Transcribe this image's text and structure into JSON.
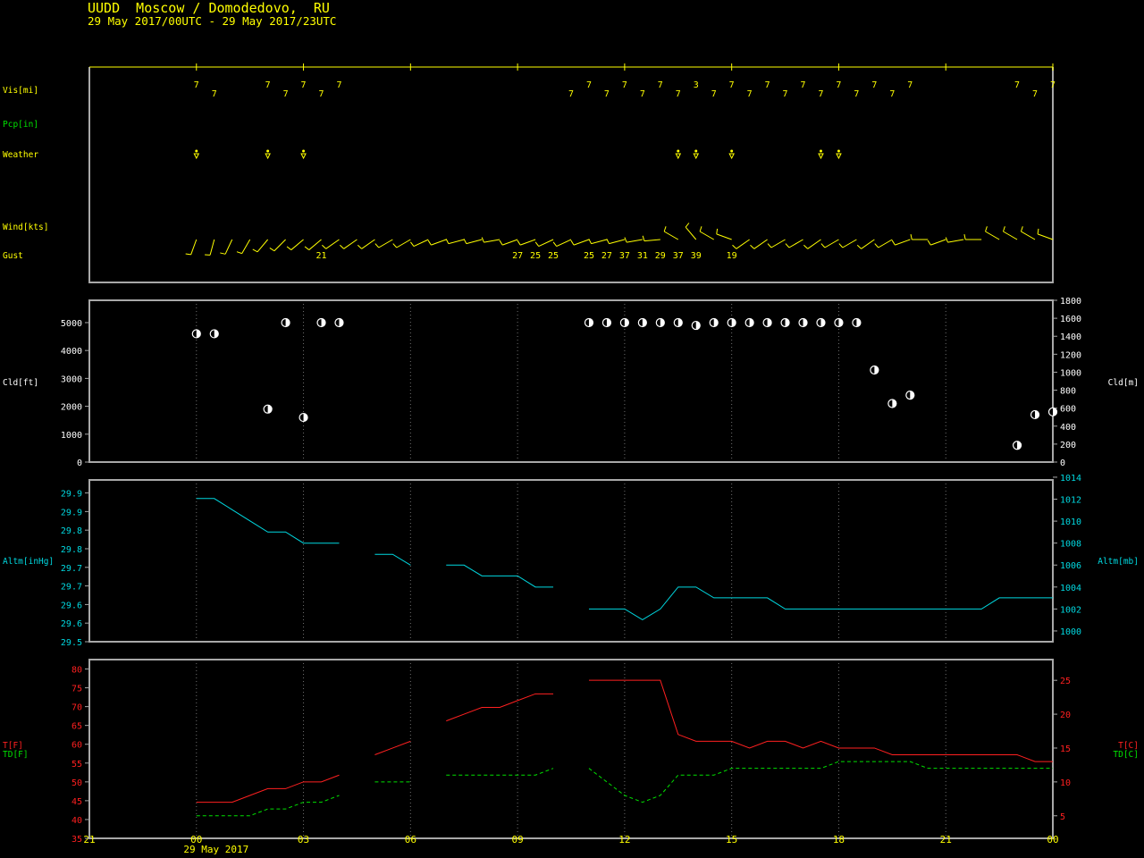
{
  "header": {
    "title": "UUDD  Moscow / Domodedovo,  RU",
    "range": "29 May 2017/00UTC - 29 May 2017/23UTC"
  },
  "time_axis": {
    "tick_labels": [
      "21",
      "00",
      "03",
      "06",
      "09",
      "12",
      "15",
      "18",
      "21",
      "00"
    ],
    "tick_hours": [
      -3,
      0,
      3,
      6,
      9,
      12,
      15,
      18,
      21,
      24
    ],
    "date_label": "29 May 2017"
  },
  "colors": {
    "background": "#000000",
    "frame": "#a8a8a8",
    "grid": "#707070",
    "yellow": "#ffff00",
    "green": "#00e000",
    "cyan": "#00d8e0",
    "red": "#ff2020",
    "white": "#ffffff"
  },
  "chart_data": [
    {
      "type": "table",
      "panel": "surface-observations",
      "rows": {
        "vis": "Vis[mi]",
        "pcp": "Pcp[in]",
        "weather": "Weather",
        "wind": "Wind[kts]",
        "gust": "Gust"
      },
      "visibility": [
        [
          0,
          "7"
        ],
        [
          0.5,
          "7"
        ],
        [
          2,
          "7"
        ],
        [
          2.5,
          "7"
        ],
        [
          3,
          "7"
        ],
        [
          3.5,
          "7"
        ],
        [
          4,
          "7"
        ],
        [
          10.5,
          "7"
        ],
        [
          11,
          "7"
        ],
        [
          11.5,
          "7"
        ],
        [
          12,
          "7"
        ],
        [
          12.5,
          "7"
        ],
        [
          13,
          "7"
        ],
        [
          13.5,
          "7"
        ],
        [
          14,
          "3"
        ],
        [
          14.5,
          "7"
        ],
        [
          15,
          "7"
        ],
        [
          15.5,
          "7"
        ],
        [
          16,
          "7"
        ],
        [
          16.5,
          "7"
        ],
        [
          17,
          "7"
        ],
        [
          17.5,
          "7"
        ],
        [
          18,
          "7"
        ],
        [
          18.5,
          "7"
        ],
        [
          19,
          "7"
        ],
        [
          19.5,
          "7"
        ],
        [
          20,
          "7"
        ],
        [
          23,
          "7"
        ],
        [
          23.5,
          "7"
        ],
        [
          24,
          "7"
        ]
      ],
      "weather_symbols": [
        0,
        2,
        3,
        13.5,
        14,
        15,
        17.5,
        18
      ],
      "wind_barbs": [
        {
          "t": 0,
          "dir": 200
        },
        {
          "t": 0.5,
          "dir": 195
        },
        {
          "t": 1,
          "dir": 205
        },
        {
          "t": 1.5,
          "dir": 210
        },
        {
          "t": 2,
          "dir": 220
        },
        {
          "t": 2.5,
          "dir": 225
        },
        {
          "t": 3,
          "dir": 230
        },
        {
          "t": 3.5,
          "dir": 230
        },
        {
          "t": 4,
          "dir": 235
        },
        {
          "t": 4.5,
          "dir": 235
        },
        {
          "t": 5,
          "dir": 235
        },
        {
          "t": 5.5,
          "dir": 240
        },
        {
          "t": 6,
          "dir": 240
        },
        {
          "t": 6.5,
          "dir": 245
        },
        {
          "t": 7,
          "dir": 250
        },
        {
          "t": 7.5,
          "dir": 255
        },
        {
          "t": 8,
          "dir": 255
        },
        {
          "t": 8.5,
          "dir": 260
        },
        {
          "t": 9,
          "dir": 250
        },
        {
          "t": 9.5,
          "dir": 250
        },
        {
          "t": 10,
          "dir": 245
        },
        {
          "t": 10.5,
          "dir": 245
        },
        {
          "t": 11,
          "dir": 250
        },
        {
          "t": 11.5,
          "dir": 255
        },
        {
          "t": 12,
          "dir": 255
        },
        {
          "t": 12.5,
          "dir": 260
        },
        {
          "t": 13,
          "dir": 265
        },
        {
          "t": 13.5,
          "dir": 300
        },
        {
          "t": 14,
          "dir": 320
        },
        {
          "t": 14.5,
          "dir": 300
        },
        {
          "t": 15,
          "dir": 290
        },
        {
          "t": 15.5,
          "dir": 235
        },
        {
          "t": 16,
          "dir": 235
        },
        {
          "t": 16.5,
          "dir": 240
        },
        {
          "t": 17,
          "dir": 240
        },
        {
          "t": 17.5,
          "dir": 235
        },
        {
          "t": 18,
          "dir": 240
        },
        {
          "t": 18.5,
          "dir": 240
        },
        {
          "t": 19,
          "dir": 235
        },
        {
          "t": 19.5,
          "dir": 240
        },
        {
          "t": 20,
          "dir": 250
        },
        {
          "t": 20.5,
          "dir": 270
        },
        {
          "t": 21,
          "dir": 250
        },
        {
          "t": 21.5,
          "dir": 260
        },
        {
          "t": 22,
          "dir": 270
        },
        {
          "t": 22.5,
          "dir": 300
        },
        {
          "t": 23,
          "dir": 300
        },
        {
          "t": 23.5,
          "dir": 300
        },
        {
          "t": 24,
          "dir": 290
        }
      ],
      "gusts": [
        [
          3.5,
          "21"
        ],
        [
          9,
          "27"
        ],
        [
          9.5,
          "25"
        ],
        [
          10,
          "25"
        ],
        [
          11,
          "25"
        ],
        [
          11.5,
          "27"
        ],
        [
          12,
          "37"
        ],
        [
          12.5,
          "31"
        ],
        [
          13,
          "29"
        ],
        [
          13.5,
          "37"
        ],
        [
          14,
          "39"
        ],
        [
          15,
          "19"
        ]
      ]
    },
    {
      "type": "scatter",
      "panel": "cloud-base",
      "ylabel": "Cld[ft]",
      "ylabel_right": "Cld[m]",
      "ylim": [
        0,
        5800
      ],
      "yticks_left": [
        0,
        1000,
        2000,
        3000,
        4000,
        5000
      ],
      "ylim_right": [
        0,
        1800
      ],
      "yticks_right": [
        0,
        200,
        400,
        600,
        800,
        1000,
        1200,
        1400,
        1600,
        1800
      ],
      "points": [
        [
          0,
          4600
        ],
        [
          0.5,
          4600
        ],
        [
          2,
          1900
        ],
        [
          2.5,
          5000
        ],
        [
          3,
          1600
        ],
        [
          3.5,
          5000
        ],
        [
          4,
          5000
        ],
        [
          11,
          5000
        ],
        [
          11.5,
          5000
        ],
        [
          12,
          5000
        ],
        [
          12.5,
          5000
        ],
        [
          13,
          5000
        ],
        [
          13.5,
          5000
        ],
        [
          14,
          4900
        ],
        [
          14.5,
          5000
        ],
        [
          15,
          5000
        ],
        [
          15.5,
          5000
        ],
        [
          16,
          5000
        ],
        [
          16.5,
          5000
        ],
        [
          17,
          5000
        ],
        [
          17.5,
          5000
        ],
        [
          18,
          5000
        ],
        [
          18.5,
          5000
        ],
        [
          19,
          3300
        ],
        [
          19.5,
          2100
        ],
        [
          20,
          2400
        ],
        [
          23,
          600
        ],
        [
          23.5,
          1700
        ],
        [
          24,
          1800
        ]
      ]
    },
    {
      "type": "line",
      "panel": "altimeter",
      "ylabel": "Altm[inHg]",
      "ylabel_right": "Altm[mb]",
      "ylim": [
        29.5,
        29.935
      ],
      "yticks_left": [
        29.5,
        29.55,
        29.6,
        29.65,
        29.7,
        29.75,
        29.8,
        29.85,
        29.9
      ],
      "ytick_labels_left": [
        "29.5",
        "29.6",
        "29.6",
        "29.7",
        "29.7",
        "29.8",
        "29.8",
        "29.9",
        "29.9"
      ],
      "ylim_right_mb": [
        999.02,
        1013.75
      ],
      "yticks_right": [
        1000,
        1002,
        1004,
        1006,
        1008,
        1010,
        1012,
        1014
      ],
      "segments": [
        [
          [
            0,
            29.885
          ],
          [
            0.5,
            29.885
          ],
          [
            1,
            29.855
          ],
          [
            1.5,
            29.825
          ],
          [
            2,
            29.795
          ],
          [
            2.5,
            29.795
          ],
          [
            3,
            29.765
          ],
          [
            3.5,
            29.765
          ],
          [
            4,
            29.765
          ]
        ],
        [
          [
            5,
            29.735
          ],
          [
            5.5,
            29.735
          ],
          [
            6,
            29.706
          ]
        ],
        [
          [
            7,
            29.706
          ],
          [
            7.5,
            29.706
          ],
          [
            8,
            29.677
          ],
          [
            8.5,
            29.677
          ],
          [
            9,
            29.677
          ],
          [
            9.5,
            29.647
          ],
          [
            10,
            29.647
          ]
        ],
        [
          [
            11,
            29.588
          ],
          [
            11.5,
            29.588
          ],
          [
            12,
            29.588
          ],
          [
            12.5,
            29.559
          ],
          [
            13,
            29.588
          ],
          [
            13.5,
            29.647
          ],
          [
            14,
            29.647
          ],
          [
            14.5,
            29.618
          ],
          [
            15,
            29.618
          ],
          [
            15.5,
            29.618
          ],
          [
            16,
            29.618
          ],
          [
            16.5,
            29.588
          ],
          [
            17,
            29.588
          ],
          [
            17.5,
            29.588
          ],
          [
            18,
            29.588
          ],
          [
            18.5,
            29.588
          ],
          [
            19,
            29.588
          ],
          [
            19.5,
            29.588
          ],
          [
            20,
            29.588
          ],
          [
            20.5,
            29.588
          ],
          [
            21,
            29.588
          ],
          [
            21.5,
            29.588
          ],
          [
            22,
            29.588
          ],
          [
            22.5,
            29.618
          ],
          [
            23,
            29.618
          ],
          [
            23.5,
            29.618
          ],
          [
            24,
            29.618
          ]
        ]
      ]
    },
    {
      "type": "line",
      "panel": "temperature-dewpoint",
      "ylabel_t": "T[F]",
      "ylabel_td": "TD[F]",
      "ylabel_right_t": "T[C]",
      "ylabel_right_td": "TD[C]",
      "ylim": [
        35,
        82.5
      ],
      "yticks_left": [
        35,
        40,
        45,
        50,
        55,
        60,
        65,
        70,
        75,
        80
      ],
      "ylim_right_c": [
        1.67,
        28.06
      ],
      "yticks_right": [
        5,
        10,
        15,
        20,
        25
      ],
      "temperature": [
        [
          [
            0,
            44.6
          ],
          [
            0.5,
            44.6
          ],
          [
            1,
            44.6
          ],
          [
            1.5,
            46.4
          ],
          [
            2,
            48.2
          ],
          [
            2.5,
            48.2
          ],
          [
            3,
            50
          ],
          [
            3.5,
            50
          ],
          [
            4,
            51.8
          ]
        ],
        [
          [
            5,
            57.2
          ],
          [
            5.5,
            59
          ],
          [
            6,
            60.8
          ]
        ],
        [
          [
            7,
            66.2
          ],
          [
            7.5,
            68
          ],
          [
            8,
            69.8
          ],
          [
            8.5,
            69.8
          ],
          [
            9,
            71.6
          ],
          [
            9.5,
            73.4
          ],
          [
            10,
            73.4
          ]
        ],
        [
          [
            11,
            77
          ],
          [
            11.5,
            77
          ],
          [
            12,
            77
          ],
          [
            12.5,
            77
          ],
          [
            13,
            77
          ],
          [
            13.5,
            62.6
          ],
          [
            14,
            60.8
          ],
          [
            14.5,
            60.8
          ],
          [
            15,
            60.8
          ],
          [
            15.5,
            59
          ],
          [
            16,
            60.8
          ],
          [
            16.5,
            60.8
          ],
          [
            17,
            59
          ],
          [
            17.5,
            60.8
          ],
          [
            18,
            59
          ],
          [
            18.5,
            59
          ],
          [
            19,
            59
          ],
          [
            19.5,
            57.2
          ],
          [
            20,
            57.2
          ],
          [
            20.5,
            57.2
          ],
          [
            21,
            57.2
          ],
          [
            21.5,
            57.2
          ],
          [
            22,
            57.2
          ],
          [
            22.5,
            57.2
          ],
          [
            23,
            57.2
          ],
          [
            23.5,
            55.4
          ],
          [
            24,
            55.4
          ]
        ]
      ],
      "dewpoint": [
        [
          [
            0,
            41
          ],
          [
            0.5,
            41
          ],
          [
            1,
            41
          ],
          [
            1.5,
            41
          ],
          [
            2,
            42.8
          ],
          [
            2.5,
            42.8
          ],
          [
            3,
            44.6
          ],
          [
            3.5,
            44.6
          ],
          [
            4,
            46.4
          ]
        ],
        [
          [
            5,
            50
          ],
          [
            5.5,
            50
          ],
          [
            6,
            50
          ]
        ],
        [
          [
            7,
            51.8
          ],
          [
            7.5,
            51.8
          ],
          [
            8,
            51.8
          ],
          [
            8.5,
            51.8
          ],
          [
            9,
            51.8
          ],
          [
            9.5,
            51.8
          ],
          [
            10,
            53.6
          ]
        ],
        [
          [
            11,
            53.6
          ],
          [
            11.5,
            50
          ],
          [
            12,
            46.4
          ],
          [
            12.5,
            44.6
          ],
          [
            13,
            46.4
          ],
          [
            13.5,
            51.8
          ],
          [
            14,
            51.8
          ],
          [
            14.5,
            51.8
          ],
          [
            15,
            53.6
          ],
          [
            15.5,
            53.6
          ],
          [
            16,
            53.6
          ],
          [
            16.5,
            53.6
          ],
          [
            17,
            53.6
          ],
          [
            17.5,
            53.6
          ],
          [
            18,
            55.4
          ],
          [
            18.5,
            55.4
          ],
          [
            19,
            55.4
          ],
          [
            19.5,
            55.4
          ],
          [
            20,
            55.4
          ],
          [
            20.5,
            53.6
          ],
          [
            21,
            53.6
          ],
          [
            21.5,
            53.6
          ],
          [
            22,
            53.6
          ],
          [
            22.5,
            53.6
          ],
          [
            23,
            53.6
          ],
          [
            23.5,
            53.6
          ],
          [
            24,
            53.6
          ]
        ]
      ]
    }
  ]
}
